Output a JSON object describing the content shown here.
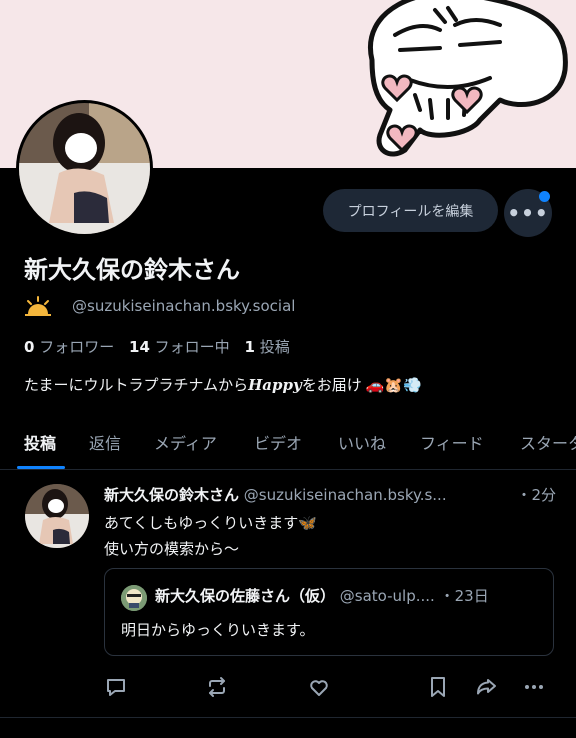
{
  "profile": {
    "display_name": "新大久保の鈴木さん",
    "handle": "@suzukiseinachan.bsky.social",
    "edit_button": "プロフィールを編集",
    "more_button": "•••",
    "stats": {
      "followers_count": "0",
      "followers_label": "フォロワー",
      "following_count": "14",
      "following_label": "フォロー中",
      "posts_count": "1",
      "posts_label": "投稿"
    },
    "bio_prefix": "たまーにウルトラプラチナムから",
    "bio_italic": "Happy",
    "bio_suffix": "をお届け",
    "bio_emoji": "🚗🐹💨"
  },
  "tabs": [
    "投稿",
    "返信",
    "メディア",
    "ビデオ",
    "いいね",
    "フィード",
    "スターター"
  ],
  "post": {
    "author_name": "新大久保の鈴木さん",
    "author_handle": "@suzukiseinachan.bsky.s...",
    "time": "・2分",
    "line1": "あてくしもゆっくりいきます🦋",
    "line2": "使い方の模索から〜",
    "quote": {
      "author_name": "新大久保の佐藤さん（仮）",
      "author_handle": "@sato-ulp....",
      "time": "・23日",
      "text": "明日からゆっくりいきます。"
    }
  },
  "colors": {
    "accent": "#1083fe",
    "background": "#000000",
    "banner": "#f6e7e9",
    "button_bg": "#1e2836",
    "muted_text": "#9aa6b4"
  },
  "icons": [
    "sun-icon",
    "reply-icon",
    "repost-icon",
    "like-icon",
    "bookmark-icon",
    "share-icon",
    "more-icon"
  ]
}
